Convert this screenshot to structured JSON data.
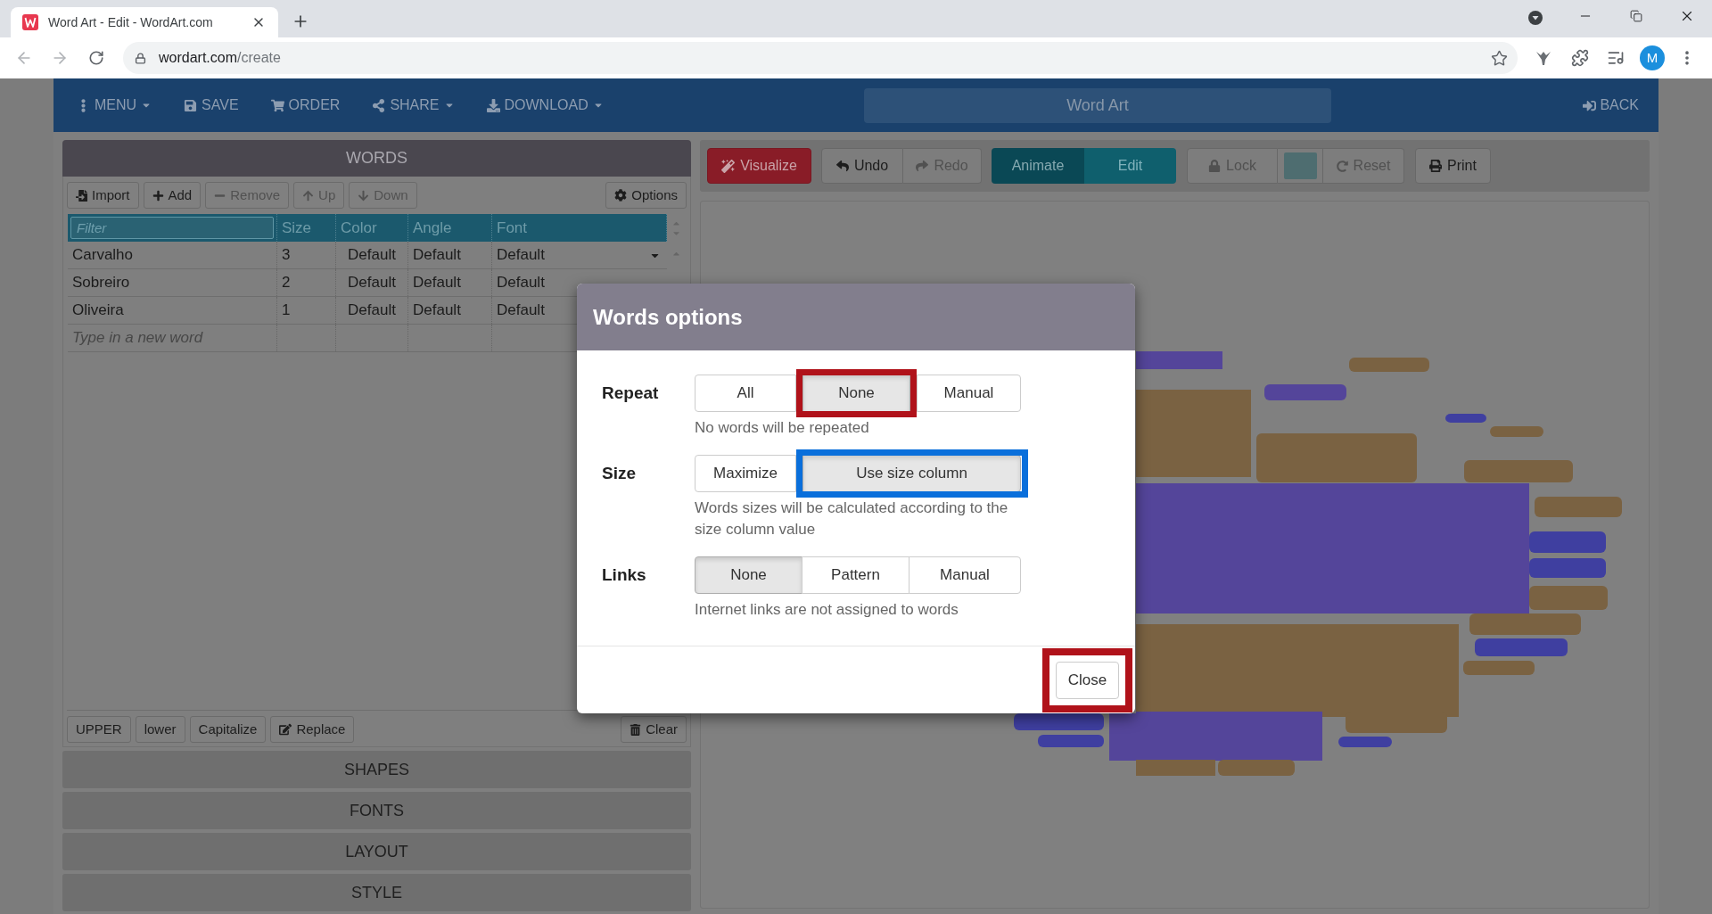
{
  "browser": {
    "tab_title": "Word Art - Edit - WordArt.com",
    "url_host": "wordart.com",
    "url_path": "/create",
    "profile_initial": "M"
  },
  "app_header": {
    "menu": [
      {
        "label": "MENU",
        "dropdown": true
      },
      {
        "label": "SAVE",
        "dropdown": false
      },
      {
        "label": "ORDER",
        "dropdown": false
      },
      {
        "label": "SHARE",
        "dropdown": true
      },
      {
        "label": "DOWNLOAD",
        "dropdown": true
      }
    ],
    "title": "Word Art",
    "back": "BACK"
  },
  "words_panel": {
    "title": "WORDS",
    "toolbar": [
      {
        "label": "Import",
        "disabled": false
      },
      {
        "label": "Add",
        "disabled": false
      },
      {
        "label": "Remove",
        "disabled": true
      },
      {
        "label": "Up",
        "disabled": true
      },
      {
        "label": "Down",
        "disabled": true
      }
    ],
    "options": "Options",
    "table": {
      "columns": [
        {
          "kind": "filter",
          "placeholder": "Filter"
        },
        {
          "kind": "label",
          "label": "Size"
        },
        {
          "kind": "label",
          "label": "Color"
        },
        {
          "kind": "label",
          "label": "Angle"
        },
        {
          "kind": "label",
          "label": "Font"
        }
      ],
      "rows": [
        {
          "cells": [
            "Carvalho",
            "3",
            "Default",
            "Default",
            "Default"
          ]
        },
        {
          "cells": [
            "Sobreiro",
            "2",
            "Default",
            "Default",
            "Default"
          ]
        },
        {
          "cells": [
            "Oliveira",
            "1",
            "Default",
            "Default",
            "Default"
          ]
        }
      ],
      "new_word_placeholder": "Type in a new word"
    },
    "case_buttons": [
      "UPPER",
      "lower",
      "Capitalize",
      "Replace"
    ],
    "clear": "Clear"
  },
  "sections": [
    "SHAPES",
    "FONTS",
    "LAYOUT",
    "STYLE"
  ],
  "canvas_toolbar": {
    "visualize": "Visualize",
    "history": [
      {
        "label": "Undo",
        "disabled": false
      },
      {
        "label": "Redo",
        "disabled": true
      }
    ],
    "modes": [
      {
        "label": "Animate",
        "selected": false
      },
      {
        "label": "Edit",
        "selected": true
      }
    ],
    "lock": {
      "label": "Lock",
      "disabled": true
    },
    "color_swatch": {
      "color": "#4e6d70"
    },
    "reset": {
      "label": "Reset",
      "disabled": true
    },
    "print": "Print"
  },
  "dialog": {
    "title": "Words options",
    "groups": [
      {
        "label": "Repeat",
        "options": [
          {
            "label": "All",
            "selected": false
          },
          {
            "label": "None",
            "selected": true,
            "highlight": {
              "color": "#b0121a"
            }
          },
          {
            "label": "Manual",
            "selected": false
          }
        ],
        "description": "No words will be repeated"
      },
      {
        "label": "Size",
        "options": [
          {
            "label": "Maximize",
            "selected": false
          },
          {
            "label": "Use size column",
            "selected": true,
            "highlight": {
              "color": "#0a6fdb"
            }
          }
        ],
        "description": "Words sizes will be calculated according to the size column value"
      },
      {
        "label": "Links",
        "options": [
          {
            "label": "None",
            "selected": true
          },
          {
            "label": "Pattern",
            "selected": false
          },
          {
            "label": "Manual",
            "selected": false
          }
        ],
        "description": "Internet links are not assigned to words"
      }
    ],
    "close": {
      "label": "Close",
      "highlight": {
        "color": "#b0121a"
      }
    }
  }
}
